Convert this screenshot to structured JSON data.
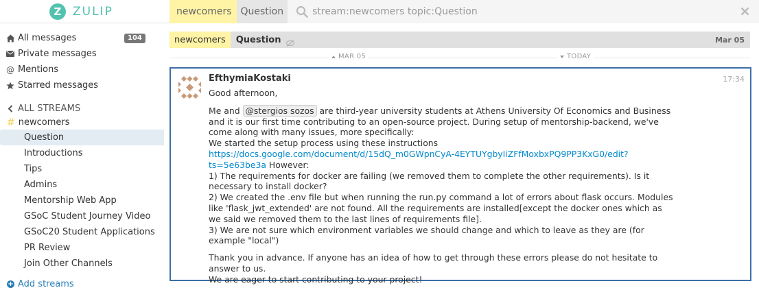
{
  "app": {
    "brand_letter": "Z",
    "brand_name": "ZULIP",
    "brand_color": "#52c2af"
  },
  "search": {
    "stream_pill": "newcomers",
    "topic_pill": "Question",
    "query": "stream:newcomers topic:Question"
  },
  "sidebar": {
    "global_filters": [
      {
        "label": "All messages",
        "icon": "home-icon",
        "count": "104"
      },
      {
        "label": "Private messages",
        "icon": "envelope-icon"
      },
      {
        "label": "Mentions",
        "icon": "at-icon"
      },
      {
        "label": "Starred messages",
        "icon": "star-icon"
      }
    ],
    "streams_header": "ALL STREAMS",
    "stream": {
      "name": "newcomers",
      "color": "#f5d76e"
    },
    "topics": [
      "Question",
      "Introductions",
      "Tips",
      "Admins",
      "Mentorship Web App",
      "GSoC Student Journey Video",
      "GSoC20 Student Applications",
      "PR Review",
      "Join Other Channels"
    ],
    "active_topic": "Question",
    "add_streams": "Add streams"
  },
  "recipient_bar": {
    "stream": "newcomers",
    "topic": "Question",
    "date": "Mar 05"
  },
  "date_separator": {
    "left": "MAR 05",
    "right": "TODAY"
  },
  "message": {
    "sender": "EfthymiaKostaki",
    "time": "17:34",
    "greeting": "Good afternoon,",
    "p1_a": "Me and ",
    "mention": "@stergios sozos",
    "p1_b": " are third-year university students at Athens University Of Economics and Business and it is our first time contributing to an open-source project. During setup of mentorship-backend, we've come along with many issues, more specifically:",
    "p2_a": "We started the setup process using these instructions ",
    "link": "https://docs.google.com/document/d/15dQ_m0GWpnCyA-4EYTUYgbyIiZFfMoxbxPQ9PP3KxG0/edit?ts=5e63be3a",
    "p2_b": " However:",
    "item1": "1) The requirements for docker are failing (we removed them to complete the other requirements). Is it necessary to install docker?",
    "item2": "2) We created the .env file but when running the run.py command a lot of errors about flask occurs. Modules like 'flask_jwt_extended' are not found. All the requirements are installed[except the docker ones which as we said we removed them to the last lines of requirements file].",
    "item3": "3) We are not sure which environment variables we should change and which to leave as they are (for example \"local\")",
    "closing1": "Thank you in advance. If anyone has an idea of how to get through these errors please do not hesitate to answer to us.",
    "closing2": "We are eager to start contributing to your project!"
  },
  "colors": {
    "selected_border": "#3a6fa8",
    "stream_pill_bg": "#fff3a5",
    "link": "#0088cc"
  }
}
